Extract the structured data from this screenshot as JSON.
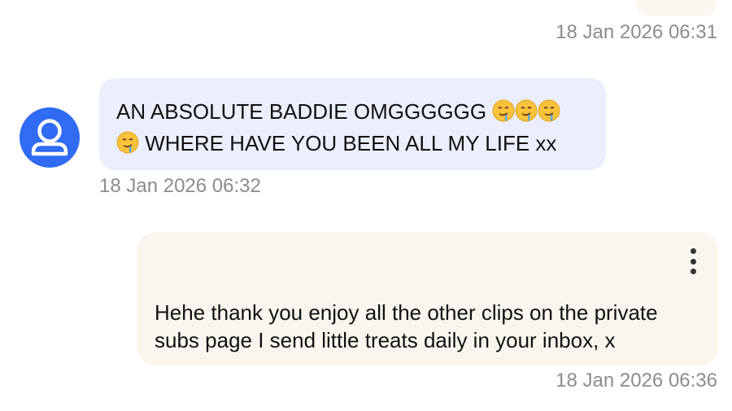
{
  "colors": {
    "incoming_bubble": "#ebeffd",
    "outgoing_bubble": "#faf6ee",
    "avatar": "#2f6bf3",
    "timestamp": "#8c8c8c"
  },
  "messages": [
    {
      "direction": "outgoing",
      "timestamp": "18 Jan 2026 06:31"
    },
    {
      "direction": "incoming",
      "avatar_icon": "user-avatar-icon",
      "line1_text": "AN ABSOLUTE BADDIE OMGGGGGG",
      "line1_emojis": [
        "drooling-face",
        "drooling-face",
        "drooling-face"
      ],
      "line2_emoji": "drooling-face",
      "line2_text": "WHERE HAVE YOU BEEN ALL MY LIFE xx",
      "timestamp": "18 Jan 2026 06:32"
    },
    {
      "direction": "outgoing",
      "text": "Hehe thank you enjoy all the other clips on the private subs page I send little treats daily in your inbox, x",
      "menu_icon": "more-options-icon",
      "timestamp": "18 Jan 2026 06:36"
    }
  ]
}
